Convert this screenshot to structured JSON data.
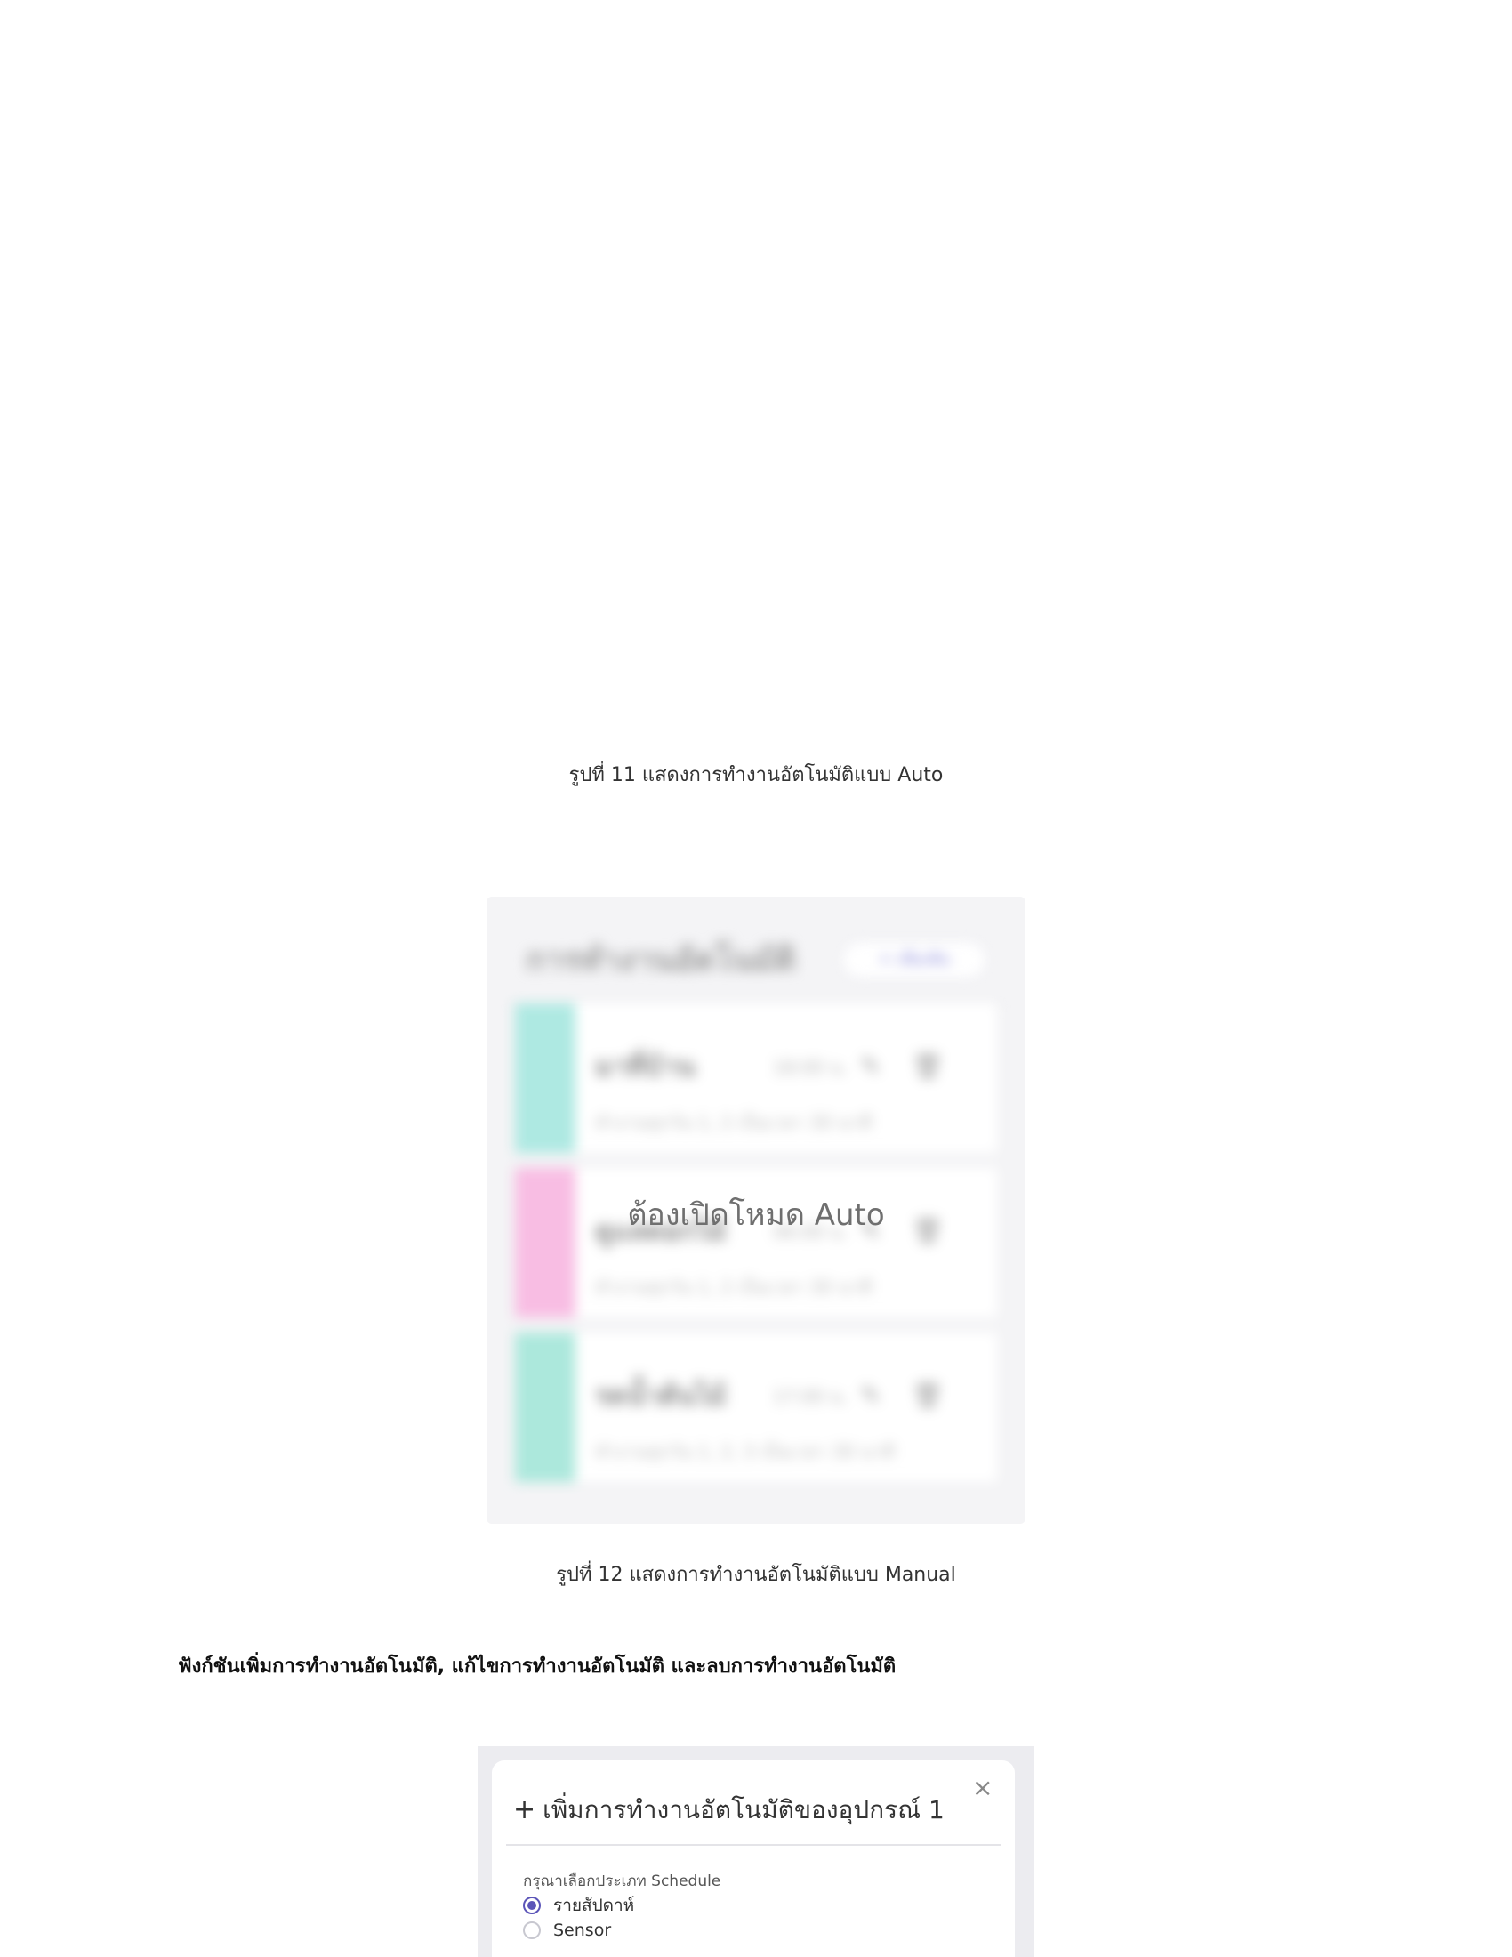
{
  "figure11": {
    "caption": "รูปที่ 11 แสดงการทำงานอัตโนมัติแบบ Auto"
  },
  "figure12": {
    "overlay_text": "ต้องเปิดโหมด Auto",
    "caption": "รูปที่ 12 แสดงการทำงานอัตโนมัติแบบ Manual",
    "stripe_colors": [
      "#aee9e2",
      "#f8bde3",
      "#ace8dc"
    ],
    "blurred_panel": {
      "title": "การทำงานอัตโนมัติ",
      "add_button": "+ เพิ่มเติม",
      "cards": [
        {
          "name": "มาที่บ้าน",
          "time": "18:00 น.",
          "detail": "ทำงานทุกวัน 1, 2 เป็นเวลา 30 นาที"
        },
        {
          "name": "ดูแลดอกไม้",
          "time": "06:00 น.",
          "detail": "ทำงานทุกวัน 1, 2 เป็นเวลา 30 นาที"
        },
        {
          "name": "รดน้ำต้นไม้",
          "time": "17:00 น.",
          "detail": "ทำงานทุกวัน 1, 2, 3 เป็นเวลา 30 นาที"
        }
      ]
    }
  },
  "section": {
    "heading": "ฟังก์ชันเพิ่มการทำงานอัตโนมัติ,  แก้ไขการทำงานอัตโนมัติ และลบการทำงานอัตโนมัติ"
  },
  "figure13": {
    "modal": {
      "plus": "+",
      "title": "เพิ่มการทำงานอัตโนมัติของอุปกรณ์ 1",
      "close": "×",
      "field_label": "กรุณาเลือกประเภท Schedule",
      "options": [
        {
          "label": "รายสัปดาห์",
          "checked": true
        },
        {
          "label": "Sensor",
          "checked": false
        }
      ],
      "accent_color": "#5b54b8"
    }
  }
}
